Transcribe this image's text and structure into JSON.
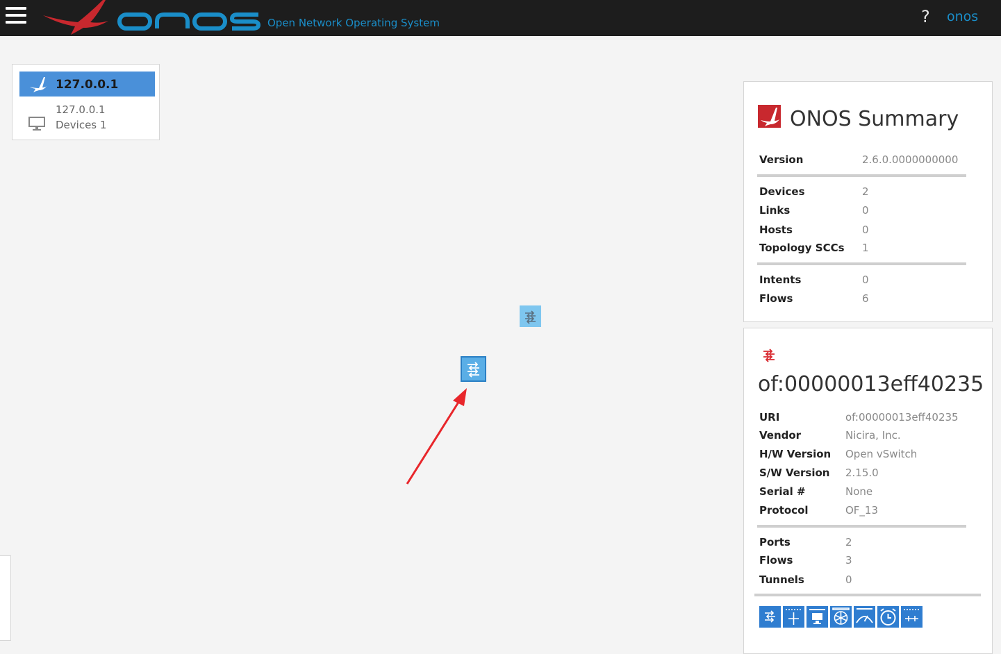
{
  "topbar": {
    "logo_text": "onos",
    "tagline": "Open Network Operating System",
    "help_label": "?",
    "user_label": "onos"
  },
  "instance": {
    "title": "127.0.0.1",
    "ip": "127.0.0.1",
    "devices_label": "Devices 1"
  },
  "summary": {
    "title": "ONOS Summary",
    "rows": [
      {
        "label": "Version",
        "value": "2.6.0.0000000000"
      },
      {
        "label": "Devices",
        "value": "2"
      },
      {
        "label": "Links",
        "value": "0"
      },
      {
        "label": "Hosts",
        "value": "0"
      },
      {
        "label": "Topology SCCs",
        "value": "1"
      },
      {
        "label": "Intents",
        "value": "0"
      },
      {
        "label": "Flows",
        "value": "6"
      }
    ]
  },
  "device": {
    "title": "of:00000013eff40235",
    "rows": [
      {
        "label": "URI",
        "value": "of:00000013eff40235"
      },
      {
        "label": "Vendor",
        "value": "Nicira, Inc."
      },
      {
        "label": "H/W Version",
        "value": "Open vSwitch"
      },
      {
        "label": "S/W Version",
        "value": "2.15.0"
      },
      {
        "label": "Serial #",
        "value": "None"
      },
      {
        "label": "Protocol",
        "value": "OF_13"
      },
      {
        "label": "Ports",
        "value": "2"
      },
      {
        "label": "Flows",
        "value": "3"
      },
      {
        "label": "Tunnels",
        "value": "0"
      }
    ],
    "action_buttons": [
      "switch-icon",
      "ports-icon",
      "hosts-icon",
      "flows-icon",
      "meters-icon",
      "timer-icon",
      "groups-icon"
    ]
  },
  "colors": {
    "topbar": "#1d1d1d",
    "accent_blue": "#1a8ec9",
    "brand_red": "#c8282e",
    "device_blue": "#7ec6ef",
    "button_blue": "#2f7dd0"
  }
}
